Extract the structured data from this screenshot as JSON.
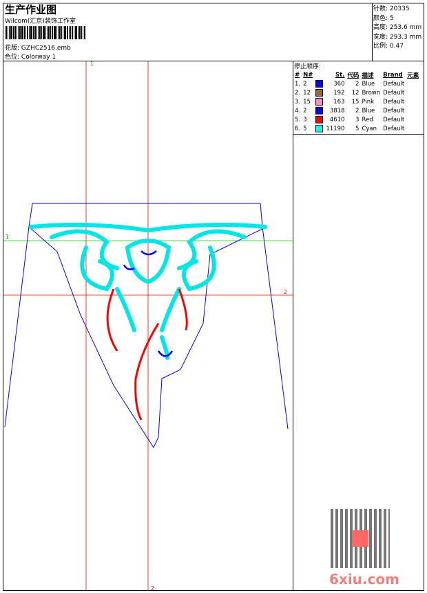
{
  "header": {
    "title": "生产作业图",
    "company": "Wilcom(汇京)装饰工作室",
    "design_label": "花版:",
    "design_value": "GZHC2516.emb",
    "colorway_label": "色位:",
    "colorway_value": "Colorway 1"
  },
  "stats": [
    {
      "label": "针数:",
      "value": "20335"
    },
    {
      "label": "颜色:",
      "value": "5"
    },
    {
      "label": "高度:",
      "value": "253.6 mm"
    },
    {
      "label": "宽度:",
      "value": "293.3 mm"
    },
    {
      "label": "比例:",
      "value": "0.47"
    }
  ],
  "sequence": {
    "title": "停止顺序:",
    "columns": [
      "#",
      "N#",
      "",
      "St.",
      "代码",
      "描述",
      "Brand",
      "元素"
    ],
    "rows": [
      {
        "idx": "1.",
        "n": "2",
        "color": "#0000ff",
        "st": "360",
        "code": "2",
        "desc": "Blue",
        "brand": "Default"
      },
      {
        "idx": "2.",
        "n": "12",
        "color": "#9b6a3a",
        "st": "192",
        "code": "12",
        "desc": "Brown",
        "brand": "Default"
      },
      {
        "idx": "3.",
        "n": "15",
        "color": "#ff88cc",
        "st": "163",
        "code": "15",
        "desc": "Pink",
        "brand": "Default"
      },
      {
        "idx": "4.",
        "n": "2",
        "color": "#0000ff",
        "st": "3818",
        "code": "2",
        "desc": "Blue",
        "brand": "Default"
      },
      {
        "idx": "5.",
        "n": "3",
        "color": "#ff0000",
        "st": "4610",
        "code": "3",
        "desc": "Red",
        "brand": "Default"
      },
      {
        "idx": "6.",
        "n": "5",
        "color": "#00ffff",
        "st": "11190",
        "code": "5",
        "desc": "Cyan",
        "brand": "Default"
      }
    ]
  },
  "guides": {
    "green_label": "1",
    "red_label": "2"
  },
  "watermark": {
    "text": "6xiu.com"
  }
}
